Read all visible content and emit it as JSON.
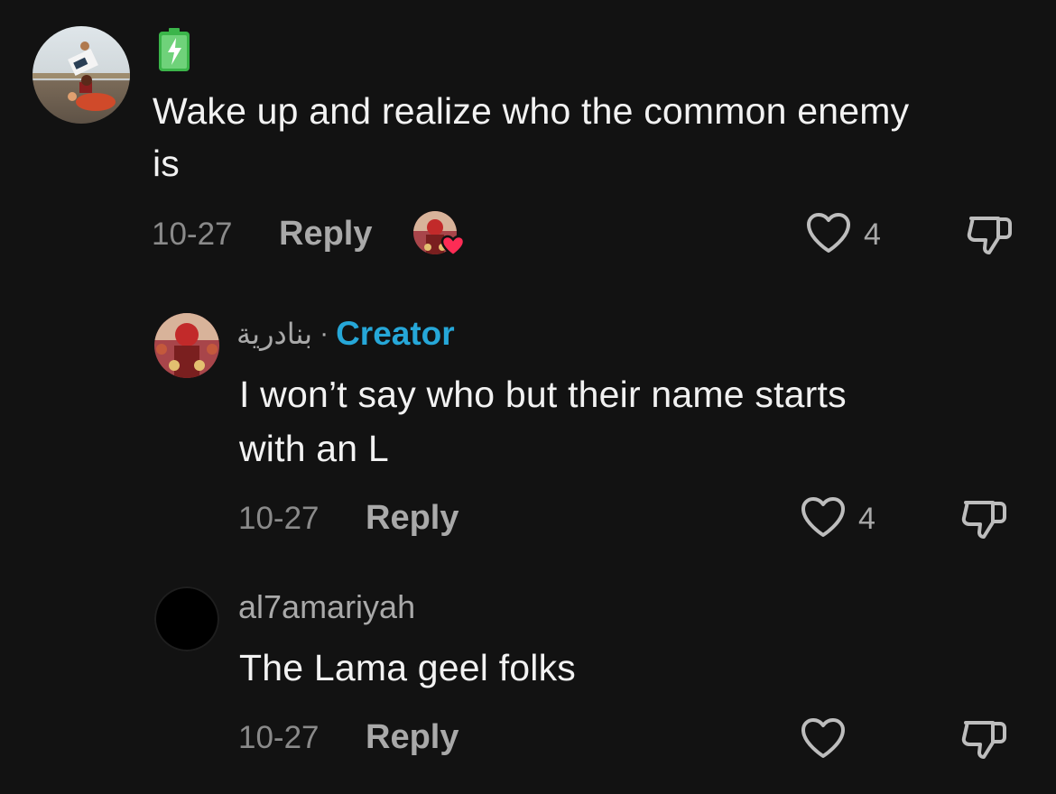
{
  "comments": [
    {
      "username": "",
      "text_line1": "Wake up and realize who the common enemy",
      "text_line2": "is",
      "date": "10-27",
      "reply_label": "Reply",
      "likes": "4",
      "flair": "battery-charging-icon"
    },
    {
      "username": "بنادرية",
      "separator": "·",
      "badge": "Creator",
      "text_line1": "I won’t say who but their name starts",
      "text_line2": "with an L",
      "date": "10-27",
      "reply_label": "Reply",
      "likes": "4"
    },
    {
      "username": "al7amariyah",
      "text_line1": "The Lama geel folks",
      "date": "10-27",
      "reply_label": "Reply",
      "likes": ""
    }
  ],
  "colors": {
    "background": "#121212",
    "creator_badge": "#26a7d8",
    "heart_badge": "#fe2c55",
    "battery": "#3bb54a"
  }
}
